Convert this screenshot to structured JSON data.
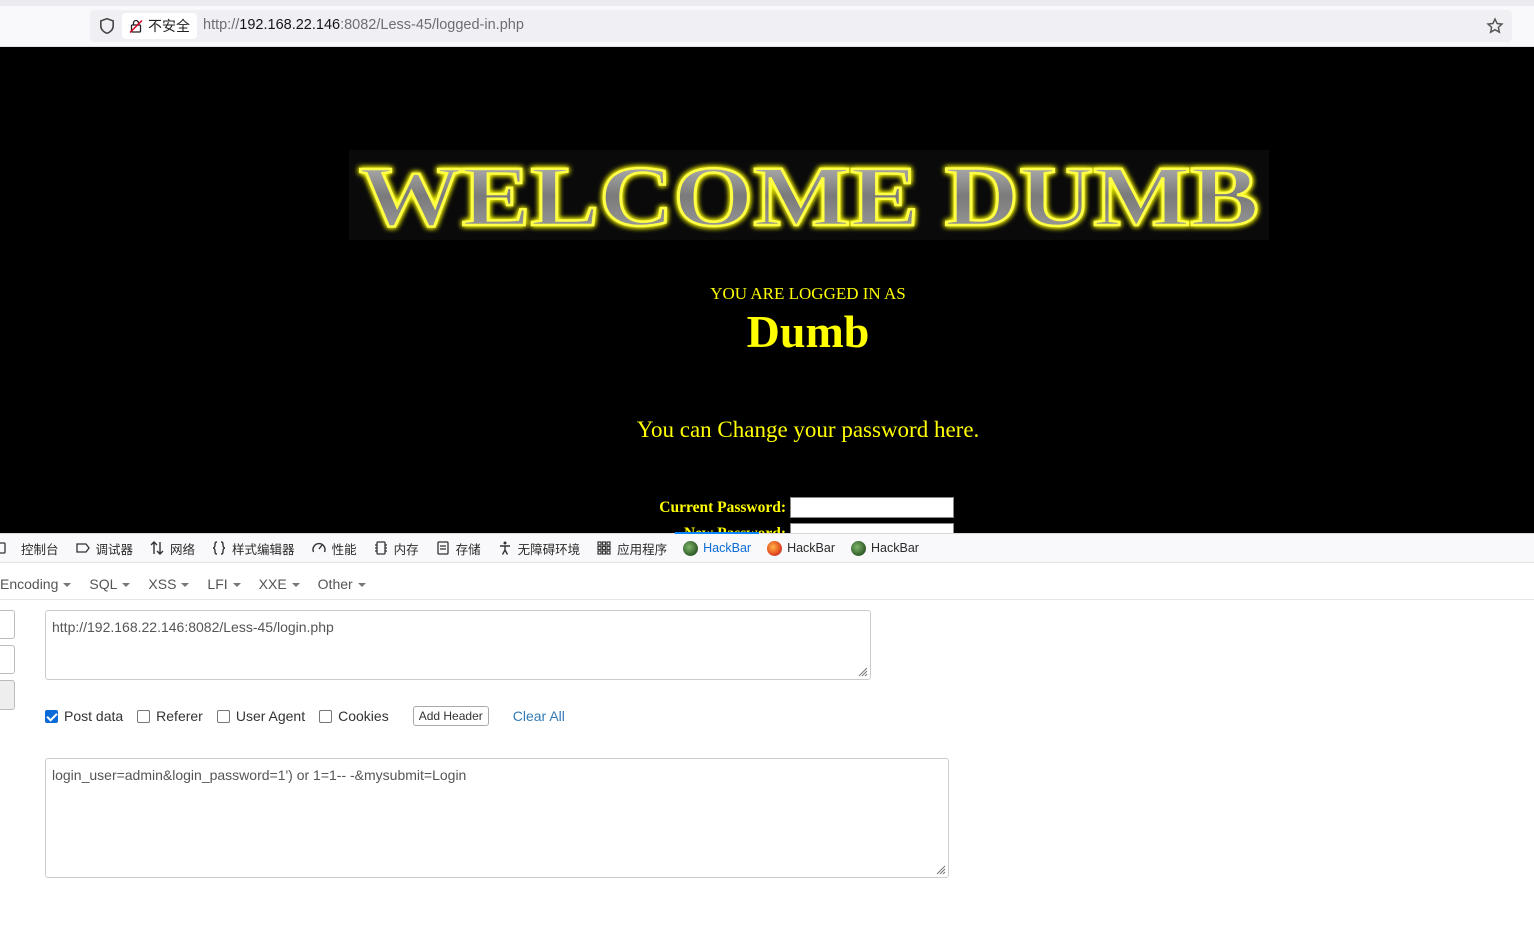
{
  "browser": {
    "security_label": "不安全",
    "url_prefix": "http://",
    "url_host": "192.168.22.146",
    "url_rest": ":8082/Less-45/logged-in.php"
  },
  "page": {
    "welcome_banner": "WELCOME DUMB",
    "logged_in_label": "YOU ARE LOGGED IN AS",
    "username": "Dumb",
    "change_password_text": "You can Change your password here.",
    "current_password_label": "Current Password:",
    "new_password_label": "New Password:"
  },
  "devtools": {
    "tabs": [
      {
        "label": "控制台",
        "icon": "console-icon"
      },
      {
        "label": "调试器",
        "icon": "debugger-icon"
      },
      {
        "label": "网络",
        "icon": "network-icon"
      },
      {
        "label": "样式编辑器",
        "icon": "style-editor-icon"
      },
      {
        "label": "性能",
        "icon": "performance-icon"
      },
      {
        "label": "内存",
        "icon": "memory-icon"
      },
      {
        "label": "存储",
        "icon": "storage-icon"
      },
      {
        "label": "无障碍环境",
        "icon": "accessibility-icon"
      },
      {
        "label": "应用程序",
        "icon": "application-icon"
      },
      {
        "label": "HackBar",
        "icon": "hackbar-green-icon",
        "active": true
      },
      {
        "label": "HackBar",
        "icon": "hackbar-orange-icon"
      },
      {
        "label": "HackBar",
        "icon": "hackbar-green-icon"
      }
    ]
  },
  "hackbar": {
    "menu": [
      "Encoding",
      "SQL",
      "XSS",
      "LFI",
      "XXE",
      "Other"
    ],
    "url_value": "http://192.168.22.146:8082/Less-45/login.php",
    "options": {
      "post_data": "Post data",
      "referer": "Referer",
      "user_agent": "User Agent",
      "cookies": "Cookies"
    },
    "add_header": "Add Header",
    "clear_all": "Clear All",
    "post_value": "login_user=admin&login_password=1') or 1=1-- -&mysubmit=Login"
  },
  "colors": {
    "accent_yellow": "#ffff00",
    "active_tab": "#0a6bd8",
    "link_blue": "#337ab7"
  }
}
